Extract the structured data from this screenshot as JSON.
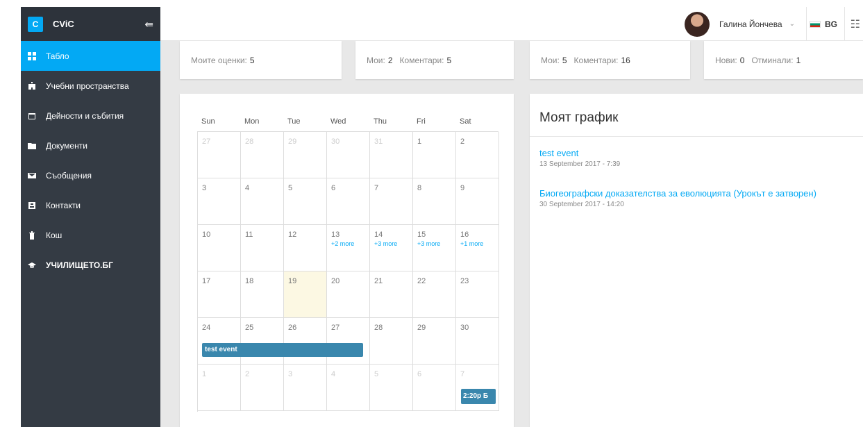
{
  "app": {
    "logo_letter": "C",
    "name": "CViC",
    "collapse_icon": "arrow-left-bars-icon"
  },
  "sidebar": {
    "items": [
      {
        "label": "Табло",
        "icon": "grid-icon",
        "active": true
      },
      {
        "label": "Учебни пространства",
        "icon": "building-icon"
      },
      {
        "label": "Дейности и събития",
        "icon": "calendar-icon"
      },
      {
        "label": "Документи",
        "icon": "folder-icon"
      },
      {
        "label": "Съобщения",
        "icon": "envelope-icon"
      },
      {
        "label": "Контакти",
        "icon": "contact-card-icon"
      },
      {
        "label": "Кош",
        "icon": "trash-icon"
      },
      {
        "label": "УЧИЛИЩЕТО.БГ",
        "icon": "graduation-cap-icon"
      }
    ]
  },
  "topbar": {
    "user_name": "Галина Йончева",
    "user_chevron": "⌄",
    "language": "BG",
    "menu_icon": "☷"
  },
  "stats": [
    {
      "label1": "Моите оценки:",
      "value1": "5"
    },
    {
      "label1": "Мои:",
      "value1": "2",
      "label2": "Коментари:",
      "value2": "5"
    },
    {
      "label1": "Мои:",
      "value1": "5",
      "label2": "Коментари:",
      "value2": "16"
    },
    {
      "label1": "Нови:",
      "value1": "0",
      "label2": "Отминали:",
      "value2": "1"
    }
  ],
  "calendar": {
    "weekdays": [
      "Sun",
      "Mon",
      "Tue",
      "Wed",
      "Thu",
      "Fri",
      "Sat"
    ],
    "weeks": [
      [
        {
          "d": "27",
          "o": true
        },
        {
          "d": "28",
          "o": true
        },
        {
          "d": "29",
          "o": true
        },
        {
          "d": "30",
          "o": true
        },
        {
          "d": "31",
          "o": true
        },
        {
          "d": "1"
        },
        {
          "d": "2"
        }
      ],
      [
        {
          "d": "3"
        },
        {
          "d": "4"
        },
        {
          "d": "5"
        },
        {
          "d": "6"
        },
        {
          "d": "7"
        },
        {
          "d": "8"
        },
        {
          "d": "9"
        }
      ],
      [
        {
          "d": "10"
        },
        {
          "d": "11"
        },
        {
          "d": "12"
        },
        {
          "d": "13",
          "more": "+2 more"
        },
        {
          "d": "14",
          "more": "+3 more"
        },
        {
          "d": "15",
          "more": "+3 more"
        },
        {
          "d": "16",
          "more": "+1 more"
        }
      ],
      [
        {
          "d": "17"
        },
        {
          "d": "18"
        },
        {
          "d": "19",
          "today": true
        },
        {
          "d": "20"
        },
        {
          "d": "21"
        },
        {
          "d": "22"
        },
        {
          "d": "23"
        }
      ],
      [
        {
          "d": "24"
        },
        {
          "d": "25"
        },
        {
          "d": "26"
        },
        {
          "d": "27"
        },
        {
          "d": "28"
        },
        {
          "d": "29"
        },
        {
          "d": "30"
        }
      ],
      [
        {
          "d": "1",
          "o": true
        },
        {
          "d": "2",
          "o": true
        },
        {
          "d": "3",
          "o": true
        },
        {
          "d": "4",
          "o": true
        },
        {
          "d": "5",
          "o": true
        },
        {
          "d": "6",
          "o": true
        },
        {
          "d": "7",
          "o": true
        }
      ]
    ],
    "event_bar": "test event",
    "event_chip": "2:20p Б"
  },
  "schedule": {
    "title": "Моят график",
    "items": [
      {
        "title": "test event",
        "date": "13 September 2017 - 7:39"
      },
      {
        "title": "Биогеографски доказателства за еволюцията (Урокът е затворен)",
        "date": "30 September 2017 - 14:20"
      }
    ]
  }
}
